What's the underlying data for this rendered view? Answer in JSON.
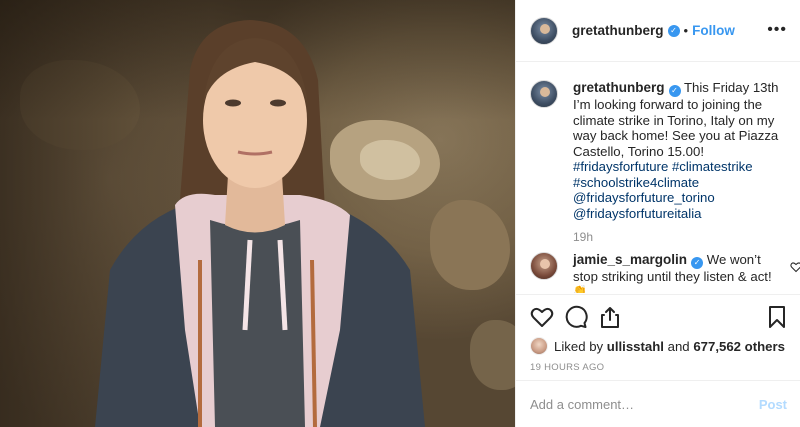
{
  "post": {
    "username": "gretathunberg",
    "follow_label": "Follow",
    "more_icon": "more-horizontal-icon",
    "separator": "•",
    "verified_mark": "✓",
    "caption_intro": "This Friday 13th I’m looking forward to joining the climate strike in Torino, Italy on my way back home! See you at Piazza Castello, Torino 15.00!",
    "hashtags": [
      "#fridaysforfuture #climatestrike",
      "#schoolstrike4climate",
      "@fridaysforfuture_torino",
      "@fridaysforfutureitalia"
    ],
    "caption_time": "19h"
  },
  "comment": {
    "username": "jamie_s_margolin",
    "text": "We won’t stop striking until they listen & act!",
    "emoji": "👏"
  },
  "actions": {
    "icons": [
      "heart-icon",
      "comment-icon",
      "share-icon",
      "bookmark-icon"
    ]
  },
  "likes": {
    "prefix": "Liked by",
    "user": "ullisstahl",
    "conjunction": "and",
    "others": "677,562 others"
  },
  "timestamp": "19 HOURS AGO",
  "add_comment": {
    "placeholder": "Add a comment…",
    "post_label": "Post"
  },
  "colors": {
    "link_blue": "#3897f0",
    "hashtag_blue": "#003569",
    "post_disabled": "#b3dbff",
    "muted_gray": "#8e8e8e"
  }
}
